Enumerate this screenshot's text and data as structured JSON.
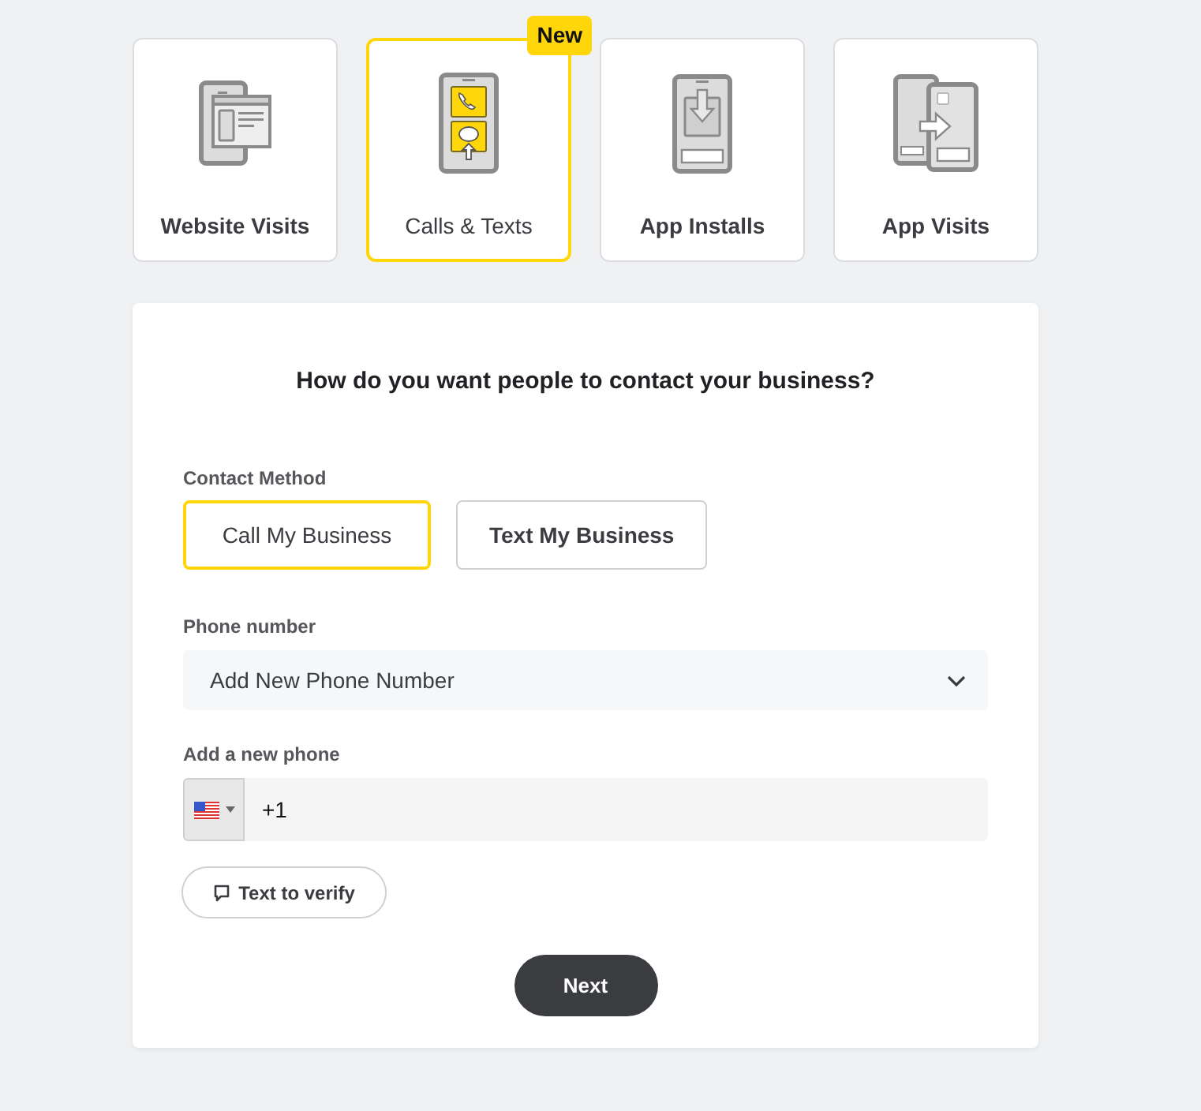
{
  "objectives": [
    {
      "kind": "website",
      "label": "Website Visits",
      "selected": false
    },
    {
      "kind": "calls",
      "label": "Calls & Texts",
      "selected": true,
      "badge": "New"
    },
    {
      "kind": "install",
      "label": "App Installs",
      "selected": false
    },
    {
      "kind": "app_visit",
      "label": "App Visits",
      "selected": false
    }
  ],
  "form": {
    "question": "How do you want people to contact your business?",
    "contact_method": {
      "label": "Contact Method",
      "options": [
        {
          "label": "Call My Business",
          "selected": true
        },
        {
          "label": "Text My Business",
          "selected": false
        }
      ]
    },
    "phone_number": {
      "label": "Phone number",
      "value": "Add New Phone Number"
    },
    "new_phone": {
      "label": "Add a new phone",
      "value": "+1"
    },
    "verify_button": "Text to verify",
    "next_button": "Next"
  }
}
